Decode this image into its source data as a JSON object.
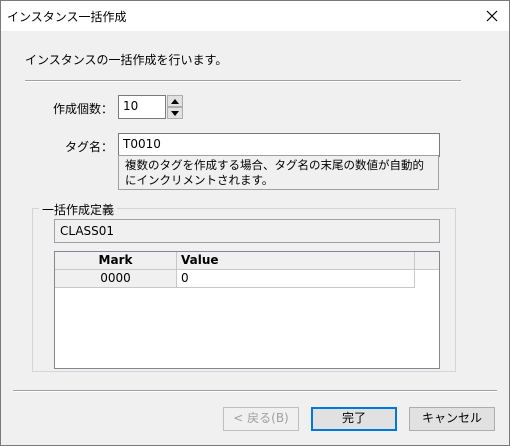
{
  "window": {
    "title": "インスタンス一括作成"
  },
  "description": "インスタンスの一括作成を行います。",
  "count": {
    "label": "作成個数：",
    "value": "10"
  },
  "tag": {
    "label": "タグ名：",
    "value": "T0010",
    "note": "複数のタグを作成する場合、タグ名の末尾の数値が自動的にインクリメントされます。"
  },
  "group": {
    "title": "一括作成定義",
    "class_name": "CLASS01",
    "columns": [
      "Mark",
      "Value"
    ],
    "rows": [
      {
        "mark": "0000",
        "value": "0"
      }
    ]
  },
  "buttons": {
    "back": "< 戻る(B)",
    "finish": "完了",
    "cancel": "キャンセル"
  },
  "icons": {
    "close": "close-icon",
    "spin_up": "arrow-up-icon",
    "spin_down": "arrow-down-icon"
  }
}
